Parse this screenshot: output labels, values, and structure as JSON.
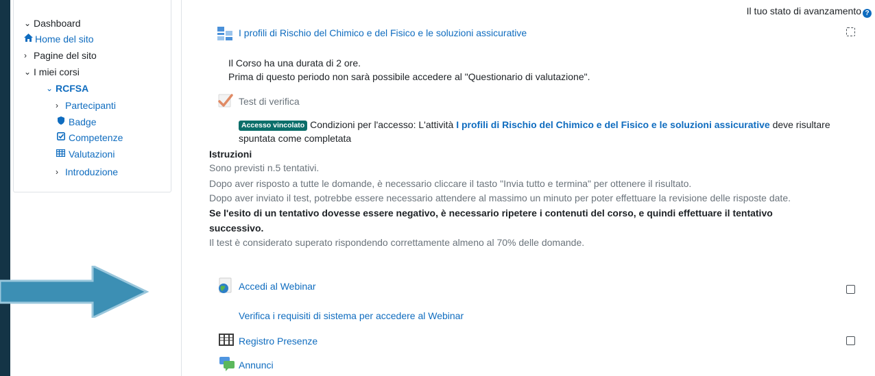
{
  "sidebar": {
    "items": [
      {
        "label": "Dashboard"
      },
      {
        "label": "Home del sito"
      },
      {
        "label": "Pagine del sito"
      },
      {
        "label": "I miei corsi"
      },
      {
        "label": "RCFSA"
      },
      {
        "label": "Partecipanti"
      },
      {
        "label": "Badge"
      },
      {
        "label": "Competenze"
      },
      {
        "label": "Valutazioni"
      },
      {
        "label": "Introduzione"
      }
    ]
  },
  "progress": {
    "label": "Il tuo stato di avanzamento",
    "help": "?"
  },
  "activities": [
    {
      "title": "I profili di Rischio del Chimico e del Fisico e le soluzioni assicurative",
      "icon": "book-icon",
      "completion": "auto-pending",
      "description": [
        "Il Corso ha una durata di 2 ore.",
        "Prima di questo periodo non sarà possibile accedere al \"Questionario di valutazione\"."
      ]
    },
    {
      "title": "Test di verifica",
      "icon": "quiz-check-icon",
      "restriction": {
        "badge": "Accesso vincolato",
        "pre": "Condizioni per l'accesso: L'attività",
        "link": "I profili di Rischio del Chimico e del Fisico e le soluzioni assicurative",
        "post": "deve risultare",
        "post2": "spuntata come completata"
      },
      "instructions": {
        "heading": "Istruzioni",
        "lines": [
          "Sono previsti n.5 tentativi.",
          "Dopo aver risposto a tutte le domande, è necessario cliccare il tasto \"Invia tutto e termina\" per ottenere il risultato.",
          "Dopo aver inviato il test, potrebbe essere necessario attendere al massimo un minuto per poter effettuare la revisione delle risposte date."
        ],
        "bold_lines": [
          "Se l'esito di un tentativo dovesse essere negativo, è necessario ripetere i contenuti del corso, e quindi effettuare il tentativo",
          "successivo."
        ],
        "last_line": "Il test è considerato superato rispondendo correttamente almeno al 70% delle domande."
      }
    },
    {
      "title": "Accedi al Webinar",
      "icon": "globe-icon",
      "completion": "manual"
    },
    {
      "title": "Verifica i requisiti di sistema per accedere al Webinar"
    },
    {
      "title": "Registro Presenze",
      "icon": "register-icon",
      "completion": "manual"
    },
    {
      "title": "Annunci",
      "icon": "forum-icon"
    }
  ],
  "colors": {
    "link": "#0f6cbf",
    "badge": "#0b6e6a",
    "arrow": "#3c8fb4",
    "background": "#1c3f54"
  }
}
